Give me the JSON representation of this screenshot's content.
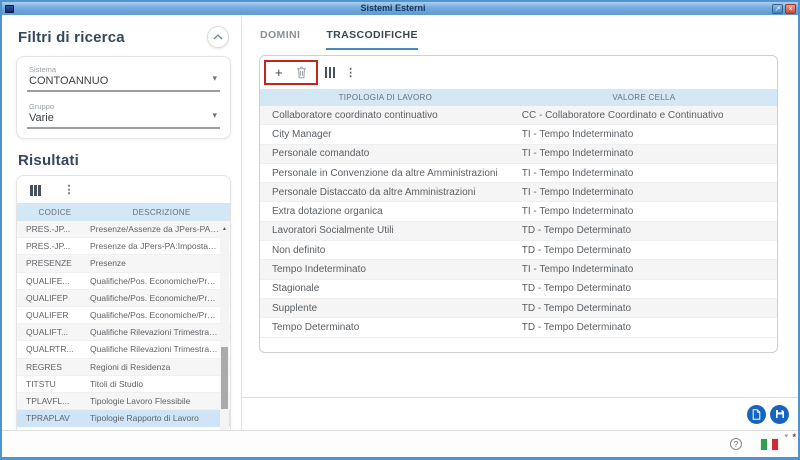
{
  "titlebar": {
    "title": "Sistemi Esterni"
  },
  "icons": {
    "caret_down": "▾",
    "plus": "+",
    "more": "⋮",
    "scroll_up": "▲",
    "scroll_down": "▼",
    "help": "?",
    "restore": "↗",
    "close": "×",
    "asterisk": "*"
  },
  "sidebar": {
    "filters_title": "Filtri di ricerca",
    "fields": [
      {
        "label": "Sistema",
        "value": "CONTOANNUO"
      },
      {
        "label": "Gruppo",
        "value": "Varie"
      }
    ],
    "results_title": "Risultati",
    "results_table": {
      "columns": [
        "CODICE",
        "DESCRIZIONE"
      ],
      "rows": [
        [
          "PRES.-JP...",
          "Presenze/Assenze da JPers-PA: Dovut..."
        ],
        [
          "PRES.-JP...",
          "Presenze da JPers-PA:Impostazioni p..."
        ],
        [
          "PRESENZE",
          "Presenze"
        ],
        [
          "QUALIFE...",
          "Qualifiche/Pos. Economiche/Profilo p..."
        ],
        [
          "QUALIFEP",
          "Qualifiche/Pos. Economiche/Profilo p..."
        ],
        [
          "QUALIFER",
          "Qualifiche/Pos. Economiche/Profilo p..."
        ],
        [
          "QUALIFT...",
          "Qualifiche Rilevazioni Trimestrali per E..."
        ],
        [
          "QUALRTR...",
          "Qualifiche Rilevazioni Trimestrali per E..."
        ],
        [
          "REGRES",
          "Regioni di Residenza"
        ],
        [
          "TITSTU",
          "Titoli di Studio"
        ],
        [
          "TPLAVFL...",
          "Tipologie Lavoro Flessibile"
        ],
        [
          "TPRAPLAV",
          "Tipologie Rapporto di Lavoro"
        ]
      ],
      "selected_code": "TPRAPLAV"
    }
  },
  "main": {
    "tabs": [
      {
        "label": "DOMINI",
        "active": false
      },
      {
        "label": "TRASCODIFICHE",
        "active": true
      }
    ],
    "table": {
      "columns": [
        "TIPOLOGIA DI LAVORO",
        "VALORE CELLA"
      ],
      "rows": [
        [
          "Collaboratore coordinato continuativo",
          "CC - Collaboratore Coordinato e Continuativo"
        ],
        [
          "City Manager",
          "TI - Tempo Indeterminato"
        ],
        [
          "Personale comandato",
          "TI - Tempo Indeterminato"
        ],
        [
          "Personale in Convenzione da altre Amministrazioni",
          "TI - Tempo Indeterminato"
        ],
        [
          "Personale Distaccato da altre Amministrazioni",
          "TI - Tempo Indeterminato"
        ],
        [
          "Extra dotazione organica",
          "TI - Tempo Indeterminato"
        ],
        [
          "Lavoratori Socialmente Utili",
          "TD - Tempo Determinato"
        ],
        [
          "Non definito",
          "TD - Tempo Determinato"
        ],
        [
          "Tempo Indeterminato",
          "TI - Tempo Indeterminato"
        ],
        [
          "Stagionale",
          "TD - Tempo Determinato"
        ],
        [
          "Supplente",
          "TD - Tempo Determinato"
        ],
        [
          "Tempo Determinato",
          "TD - Tempo Determinato"
        ]
      ]
    }
  },
  "colors": {
    "window_border": "#4f94cd",
    "table_header_bg": "#d4e7f5",
    "selected_row_bg": "#cfe5f7",
    "accent_button": "#1565c0",
    "annotation_red": "#c3261c",
    "active_tab_underline": "#4a86c4"
  }
}
